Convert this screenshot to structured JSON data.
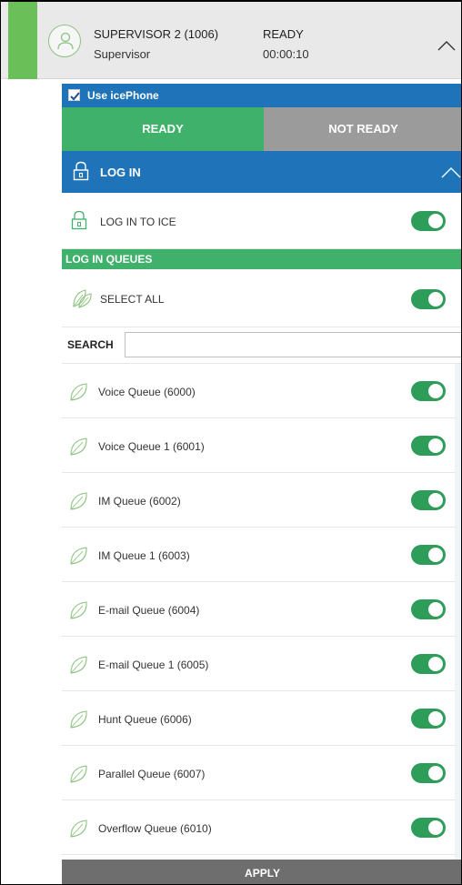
{
  "header": {
    "agent_name": "SUPERVISOR 2 (1006)",
    "agent_role": "Supervisor",
    "status": "READY",
    "status_time": "00:00:10",
    "accent_color": "#6bbf59"
  },
  "icephone": {
    "label": "Use icePhone",
    "checked": true
  },
  "state_tabs": {
    "ready": "READY",
    "not_ready": "NOT READY",
    "active": "READY"
  },
  "login": {
    "section_title": "LOG IN",
    "login_to_ice_label": "LOG IN TO ICE",
    "login_to_ice_on": true
  },
  "queues": {
    "section_title": "LOG IN QUEUES",
    "select_all_label": "SELECT ALL",
    "select_all_on": true,
    "search_label": "SEARCH",
    "search_value": "",
    "items": [
      {
        "label": "Voice Queue (6000)",
        "on": true
      },
      {
        "label": "Voice Queue 1 (6001)",
        "on": true
      },
      {
        "label": "IM Queue (6002)",
        "on": true
      },
      {
        "label": "IM Queue 1 (6003)",
        "on": true
      },
      {
        "label": "E-mail Queue (6004)",
        "on": true
      },
      {
        "label": "E-mail Queue 1 (6005)",
        "on": true
      },
      {
        "label": "Hunt Queue (6006)",
        "on": true
      },
      {
        "label": "Parallel Queue (6007)",
        "on": true
      },
      {
        "label": "Overflow Queue (6010)",
        "on": true
      }
    ]
  },
  "apply_label": "APPLY",
  "colors": {
    "blue": "#1f73b8",
    "green": "#3fb16b",
    "toggle_green": "#2f9d5a",
    "grey": "#9b9b9b"
  }
}
